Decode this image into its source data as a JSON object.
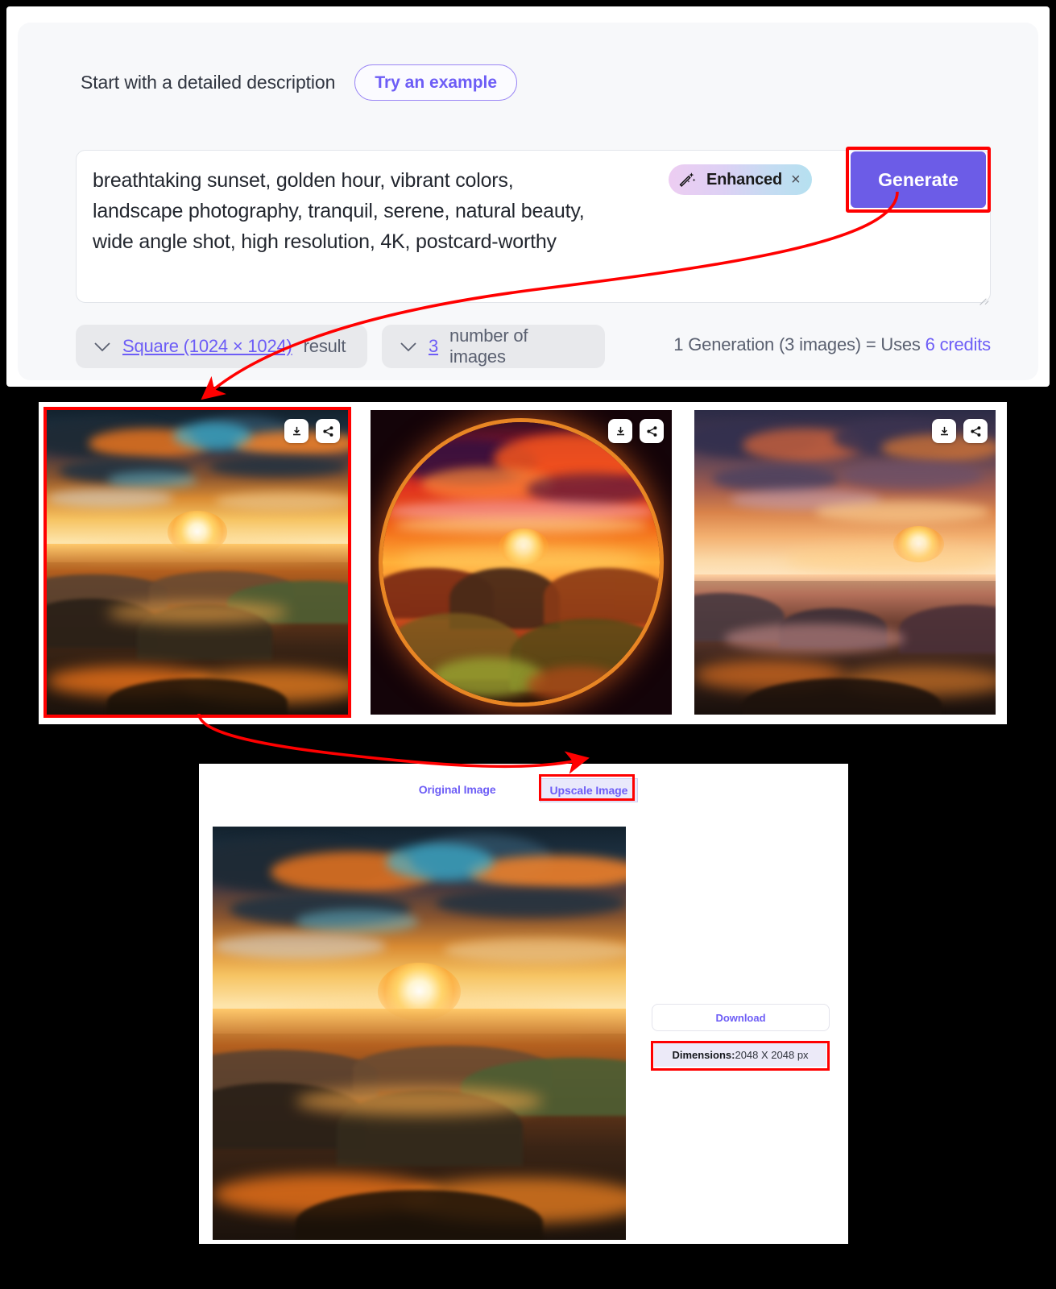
{
  "generator": {
    "heading": "Start with a detailed description",
    "try_example_label": "Try an example",
    "prompt_value": "breathtaking sunset, golden hour, vibrant colors, landscape photography, tranquil, serene, natural beauty, wide angle shot, high resolution, 4K, postcard-worthy",
    "prompt_placeholder": "Start with a detailed description",
    "enhanced_badge": {
      "icon": "magic-wand-icon",
      "label": "Enhanced",
      "close": "×",
      "gradient_start": "#edcdf2",
      "gradient_end": "#b5e0f0"
    },
    "generate_label": "Generate",
    "generate_color": "#6c5ce7",
    "controls": {
      "aspect": {
        "chevron": "chevron-down-icon",
        "value": "Square (1024 × 1024)",
        "suffix": "result"
      },
      "count": {
        "chevron": "chevron-down-icon",
        "value": "3",
        "suffix": "number of images"
      }
    },
    "credits_text_prefix": "1 Generation (3 images) = Uses ",
    "credits_value": "6 credits",
    "accent_color": "#6d5df6"
  },
  "results": {
    "cards": [
      {
        "name": "result-image-1",
        "alt": "Golden hour sunset over layered mountain ridges with blue and orange streaked clouds",
        "selected": true,
        "download_label": "download-icon",
        "share_label": "share-icon"
      },
      {
        "name": "result-image-2",
        "alt": "Circular fisheye sunset over crimson rocky valley with green foliage",
        "selected": false,
        "download_label": "download-icon",
        "share_label": "share-icon"
      },
      {
        "name": "result-image-3",
        "alt": "Purple and orange sunset over misty lake islands",
        "selected": false,
        "download_label": "download-icon",
        "share_label": "share-icon"
      }
    ]
  },
  "upscale": {
    "tabs": [
      {
        "label": "Original Image",
        "active": false
      },
      {
        "label": "Upscale Image",
        "active": true
      }
    ],
    "image_alt": "Upscaled golden hour sunset over layered mountain ridges",
    "download_label": "Download",
    "dimensions_label": "Dimensions:",
    "dimensions_value": " 2048 X 2048 px"
  },
  "annotations": {
    "highlight_color": "#ff0000",
    "arrow_1": "Generate button to first result image",
    "arrow_2": "First result image to Upscale Image tab"
  }
}
